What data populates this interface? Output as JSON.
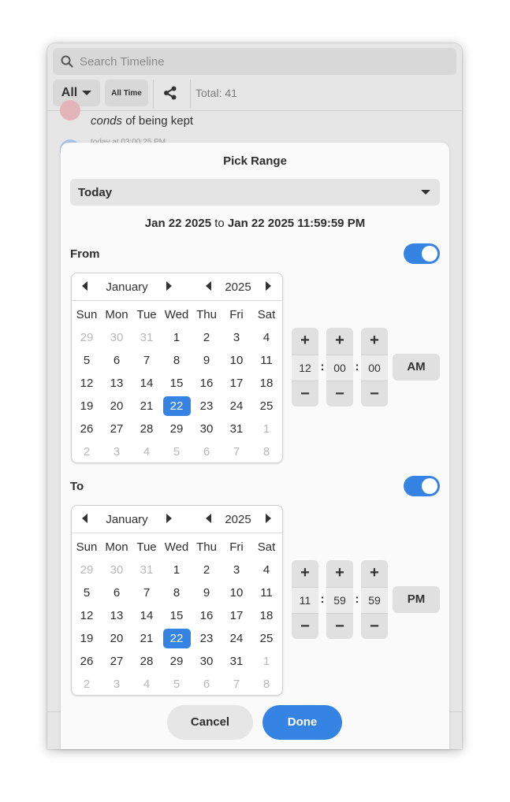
{
  "timeline": {
    "search_placeholder": "Search Timeline",
    "filter_label": "All",
    "time_label": "All Time",
    "total_label": "Total: 41",
    "entry_text_em": "conds",
    "entry_text_rest": " of being kept",
    "entry_time": "today at 03:00:25 PM"
  },
  "dialog": {
    "title": "Pick Range",
    "preset": "Today",
    "range": {
      "from": "Jan 22 2025",
      "sep": "to",
      "to": "Jan 22 2025 11:59:59 PM"
    },
    "from": {
      "label": "From",
      "toggle_on": true,
      "month": "January",
      "year": "2025",
      "hour": "12",
      "minute": "00",
      "second": "00",
      "ampm": "AM"
    },
    "to": {
      "label": "To",
      "toggle_on": true,
      "month": "January",
      "year": "2025",
      "hour": "11",
      "minute": "59",
      "second": "59",
      "ampm": "PM"
    },
    "weekdays": [
      "Sun",
      "Mon",
      "Tue",
      "Wed",
      "Thu",
      "Fri",
      "Sat"
    ],
    "weeks": [
      [
        "29",
        "30",
        "31",
        "1",
        "2",
        "3",
        "4"
      ],
      [
        "5",
        "6",
        "7",
        "8",
        "9",
        "10",
        "11"
      ],
      [
        "12",
        "13",
        "14",
        "15",
        "16",
        "17",
        "18"
      ],
      [
        "19",
        "20",
        "21",
        "22",
        "23",
        "24",
        "25"
      ],
      [
        "26",
        "27",
        "28",
        "29",
        "30",
        "31",
        "1"
      ],
      [
        "2",
        "3",
        "4",
        "5",
        "6",
        "7",
        "8"
      ]
    ],
    "selected_day": "22",
    "plus": "+",
    "minus": "−",
    "colon": ":",
    "cancel": "Cancel",
    "done": "Done"
  },
  "colors": {
    "accent": "#3584e4",
    "dim_day": "#b8b8b8"
  },
  "icons": {
    "search": "search-icon",
    "share": "share-icon"
  }
}
